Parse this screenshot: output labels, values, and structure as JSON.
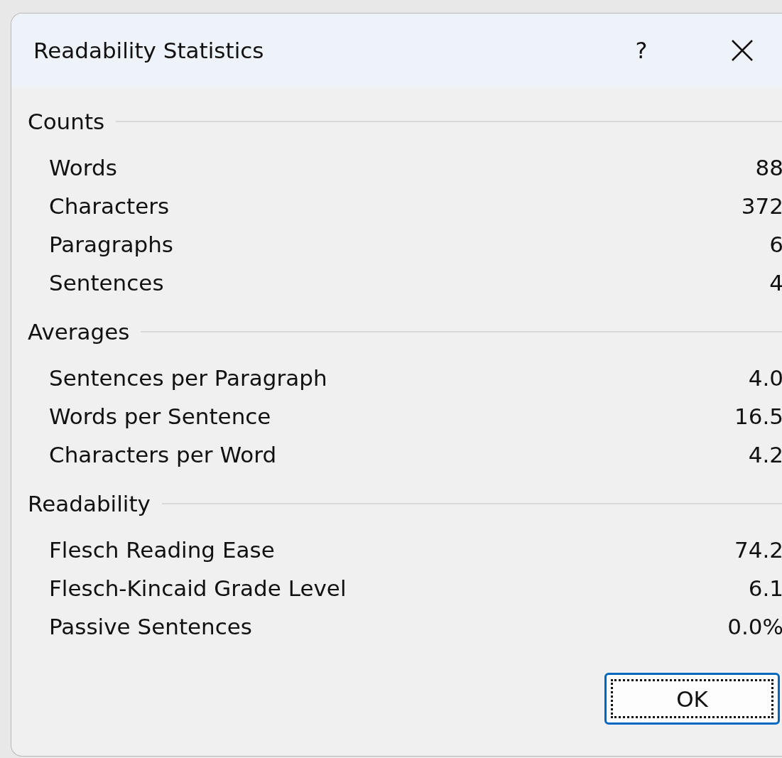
{
  "window": {
    "title": "Readability Statistics",
    "help": "?"
  },
  "sections": [
    {
      "heading": "Counts",
      "rows": [
        {
          "label": "Words",
          "value": "88"
        },
        {
          "label": "Characters",
          "value": "372"
        },
        {
          "label": "Paragraphs",
          "value": "6"
        },
        {
          "label": "Sentences",
          "value": "4"
        }
      ]
    },
    {
      "heading": "Averages",
      "rows": [
        {
          "label": "Sentences per Paragraph",
          "value": "4.0"
        },
        {
          "label": "Words per Sentence",
          "value": "16.5"
        },
        {
          "label": "Characters per Word",
          "value": "4.2"
        }
      ]
    },
    {
      "heading": "Readability",
      "rows": [
        {
          "label": "Flesch Reading Ease",
          "value": "74.2"
        },
        {
          "label": "Flesch-Kincaid Grade Level",
          "value": "6.1"
        },
        {
          "label": "Passive Sentences",
          "value": "0.0%"
        }
      ]
    }
  ],
  "buttons": [
    "OK"
  ]
}
